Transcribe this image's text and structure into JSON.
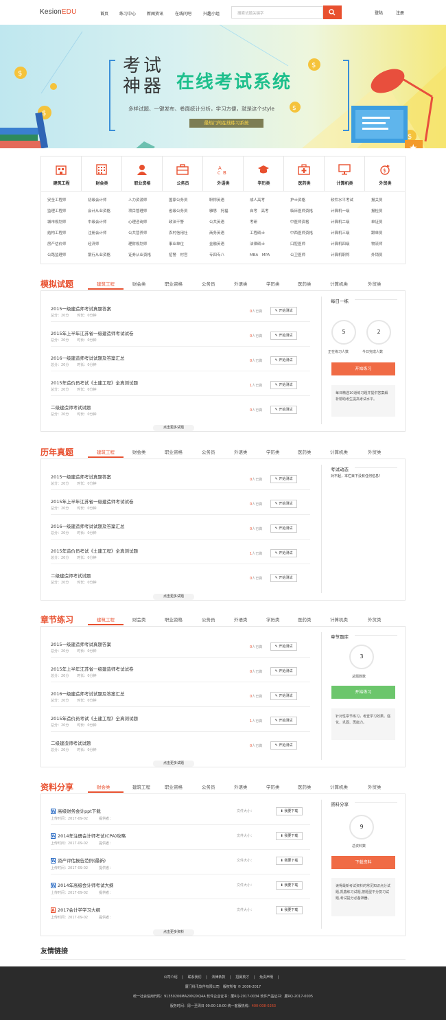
{
  "header": {
    "logo_main": "Kesion",
    "logo_accent": "EDU",
    "nav": [
      "首页",
      "练习中心",
      "新闻资讯",
      "在线问吧",
      "兴趣小组"
    ],
    "search_placeholder": "搜索试题关键字",
    "login": "登陆",
    "register": "注册"
  },
  "banner": {
    "title_left": "考试\n神器",
    "title_right": "在线考试系统",
    "subtitle": "多样试题、一键发布、卷面统计分析，学习方便，就是这个style",
    "tag": "最热门的在线练习系统"
  },
  "categories": [
    {
      "label": "建筑工程",
      "icon": "building-icon",
      "items": [
        "安全工程师",
        "监理工程师",
        "城市规划师",
        "结构工程师",
        "房产估价师",
        "公路监理师"
      ]
    },
    {
      "label": "财会类",
      "icon": "calculator-icon",
      "items": [
        "初级会计师",
        "会计从业资格",
        "中级会计师",
        "注册会计师",
        "经济师",
        "银行从业资格"
      ]
    },
    {
      "label": "职业资格",
      "icon": "person-icon",
      "items": [
        "人力资源师",
        "项目管理师",
        "心理咨询师",
        "公共营养师",
        "理财规划师",
        "证券从业资格"
      ]
    },
    {
      "label": "公务员",
      "icon": "briefcase-icon",
      "items": [
        "国家公务员",
        "省级公务员",
        "政法干警",
        "农村信用社",
        "事业单位",
        "招警　村官"
      ]
    },
    {
      "label": "外语类",
      "icon": "abc-icon",
      "items": [
        "职称英语",
        "雅思　托福",
        "公共英语",
        "商务英语",
        "金融英语",
        "专四专八"
      ]
    },
    {
      "label": "学历类",
      "icon": "graduation-cap-icon",
      "items": [
        "成人高考",
        "自考　高考",
        "考研",
        "工程硕士",
        "法律硕士",
        "MBA　MPA"
      ]
    },
    {
      "label": "医药类",
      "icon": "medical-kit-icon",
      "items": [
        "护士资格",
        "临床医师资格",
        "中医师资格",
        "中西医师资格",
        "口腔医师",
        "公卫医师"
      ]
    },
    {
      "label": "计算机类",
      "icon": "monitor-icon",
      "items": [
        "软件水平考试",
        "计算机一级",
        "计算机二级",
        "计算机三级",
        "计算机四级",
        "计算机职称"
      ]
    },
    {
      "label": "外贸类",
      "icon": "trade-icon",
      "items": [
        "报关员",
        "报检员",
        "单证员",
        "跟单员",
        "物流师",
        "外销员"
      ]
    }
  ],
  "tabs_default": [
    "建筑工程",
    "财会类",
    "职业资格",
    "公务员",
    "外语类",
    "学历类",
    "医药类",
    "计算机类",
    "外贸类"
  ],
  "tabs_resources": [
    "财会类",
    "建筑工程",
    "职业资格",
    "公务员",
    "外语类",
    "学历类",
    "医药类",
    "计算机类",
    "外贸类"
  ],
  "mock": {
    "title": "模拟试题",
    "rows": [
      {
        "title": "2015一级建造师考试真题答案",
        "score": "总分：20分",
        "time": "时长：0分钟",
        "count": "0",
        "count_suffix": "人已做",
        "btn": "开始测试"
      },
      {
        "title": "2015年上半年江苏省一级建造师考试试卷",
        "score": "总分：20分",
        "time": "时长：0分钟",
        "count": "0",
        "count_suffix": "人已做",
        "btn": "开始测试"
      },
      {
        "title": "2016一级建造师考试试题及答案汇总",
        "score": "总分：20分",
        "time": "时长：0分钟",
        "count": "0",
        "count_suffix": "人已做",
        "btn": "开始测试"
      },
      {
        "title": "2015年造价员考试《土建工程》全真测试题",
        "score": "总分：20分",
        "time": "时长：0分钟",
        "count": "1",
        "count_suffix": "人已做",
        "btn": "开始测试"
      },
      {
        "title": "二级建造师考试试题",
        "score": "总分：20分",
        "time": "时长：0分钟",
        "count": "0",
        "count_suffix": "人已做",
        "btn": "开始测试"
      }
    ],
    "more": "点击更多试题",
    "side_title": "每日一练",
    "stat1_value": "5",
    "stat1_label": "正在练习人数",
    "stat2_value": "2",
    "stat2_label": "今日完成人数",
    "side_btn": "开始练习",
    "side_note": "每日精选10道练习题并提供答案解析帮助考生提高考试水平。"
  },
  "past": {
    "title": "历年真题",
    "rows": [
      {
        "title": "2015一级建造师考试真题答案",
        "score": "总分：20分",
        "time": "时长：0分钟",
        "count": "0",
        "count_suffix": "人已做",
        "btn": "开始测试"
      },
      {
        "title": "2015年上半年江苏省一级建造师考试试卷",
        "score": "总分：20分",
        "time": "时长：0分钟",
        "count": "0",
        "count_suffix": "人已做",
        "btn": "开始测试"
      },
      {
        "title": "2016一级建造师考试试题及答案汇总",
        "score": "总分：20分",
        "time": "时长：0分钟",
        "count": "0",
        "count_suffix": "人已做",
        "btn": "开始测试"
      },
      {
        "title": "2015年造价员考试《土建工程》全真测试题",
        "score": "总分：20分",
        "time": "时长：0分钟",
        "count": "1",
        "count_suffix": "人已做",
        "btn": "开始测试"
      },
      {
        "title": "二级建造师考试试题",
        "score": "总分：20分",
        "time": "时长：0分钟",
        "count": "0",
        "count_suffix": "人已做",
        "btn": "开始测试"
      }
    ],
    "more": "点击更多试题",
    "side_title": "考试动态",
    "side_text": "对不起，本栏目下没有任何信息！"
  },
  "chapter": {
    "title": "章节练习",
    "rows": [
      {
        "title": "2015一级建造师考试真题答案",
        "score": "总分：20分",
        "time": "时长：0分钟",
        "count": "0",
        "count_suffix": "人已做",
        "btn": "开始测试"
      },
      {
        "title": "2015年上半年江苏省一级建造师考试试卷",
        "score": "总分：20分",
        "time": "时长：0分钟",
        "count": "0",
        "count_suffix": "人已做",
        "btn": "开始测试"
      },
      {
        "title": "2016一级建造师考试试题及答案汇总",
        "score": "总分：20分",
        "time": "时长：0分钟",
        "count": "0",
        "count_suffix": "人已做",
        "btn": "开始测试"
      },
      {
        "title": "2015年造价员考试《土建工程》全真测试题",
        "score": "总分：20分",
        "time": "时长：0分钟",
        "count": "1",
        "count_suffix": "人已做",
        "btn": "开始测试"
      },
      {
        "title": "二级建造师考试试题",
        "score": "总分：20分",
        "time": "时长：0分钟",
        "count": "0",
        "count_suffix": "人已做",
        "btn": "开始测试"
      }
    ],
    "more": "点击更多试题",
    "side_title": "章节题库",
    "stat_value": "3",
    "stat_label": "总题数数",
    "side_btn": "开始练习",
    "side_note": "针对性章节练习，考查学习效果。强化、巩固、再能力。"
  },
  "resources": {
    "title": "资料分享",
    "rows": [
      {
        "icon": "word-doc-icon",
        "glyph": "W",
        "title": "高级财务会计ppt下载",
        "date": "上传时间：2017-09-02",
        "provider": "提供者：",
        "size": "文件大小：",
        "btn": "我要下载"
      },
      {
        "icon": "word-doc-icon",
        "glyph": "W",
        "title": "2014年注册会计师考试(CPA)攻略",
        "date": "上传时间：2017-09-02",
        "provider": "提供者：",
        "size": "文件大小：",
        "btn": "我要下载"
      },
      {
        "icon": "word-doc-icon",
        "glyph": "W",
        "title": "资产评估报告范例(最新)",
        "date": "上传时间：2017-09-02",
        "provider": "提供者：",
        "size": "文件大小：",
        "btn": "我要下载"
      },
      {
        "icon": "word-doc-icon",
        "glyph": "W",
        "title": "2014年高级会计师考试大纲",
        "date": "上传时间：2017-09-02",
        "provider": "提供者：",
        "size": "文件大小：",
        "btn": "我要下载"
      },
      {
        "icon": "pdf-doc-icon",
        "glyph": "A",
        "title": "2017会计学学习大纲",
        "date": "上传时间：2017-09-02",
        "provider": "提供者：",
        "size": "文件大小：",
        "btn": "我要下载"
      }
    ],
    "more": "点击更多资料",
    "side_title": "资料分享",
    "stat_value": "9",
    "stat_label": "总资料数",
    "side_btn": "下载资料",
    "side_note": "读得最新考试资料的常见知识点分试题,凯鑫练习试题,按题型平分复习试题,考试提分必备神器。"
  },
  "links_title": "友情链接",
  "footer": {
    "links": [
      "公司介绍",
      "联系我们",
      "法律条款",
      "招募英才",
      "免责声明"
    ],
    "line2": "厦门科汛软件有限公司　版权所有 © 2006-2017",
    "line3": "统一社会信用代码：91350206MA2XN2XQ4A 软件企业证书：厦RQ-2017-0034 软件产品证书：厦RQ-2017-0005",
    "line4": "服务时间：周一至周日 09:00-18:00 统一客服热线：",
    "phone": "400-008-0263"
  },
  "colors": {
    "accent": "#e8502f",
    "green": "#6cc66c",
    "banner_green": "#1dbf8c"
  }
}
